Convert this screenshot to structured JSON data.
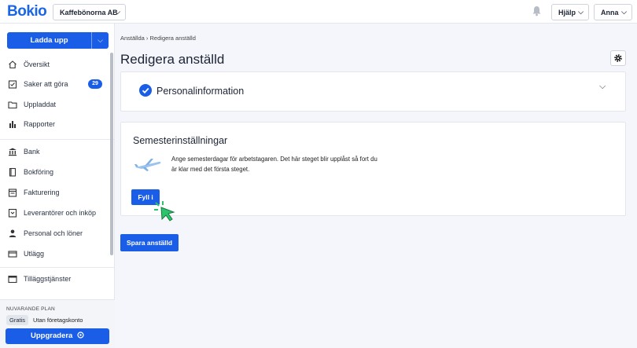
{
  "app": {
    "logo": "Bokio",
    "company": "Kaffebönorna AB",
    "help_label": "Hjälp",
    "user_label": "Anna",
    "accent": "#1a5ee8"
  },
  "sidebar": {
    "upload_label": "Ladda upp",
    "items": [
      {
        "label": "Översikt",
        "icon": "home-icon"
      },
      {
        "label": "Saker att göra",
        "icon": "checklist-icon",
        "badge": "29"
      },
      {
        "label": "Uppladdat",
        "icon": "folder-icon"
      },
      {
        "label": "Rapporter",
        "icon": "bar-chart-icon"
      },
      {
        "label": "Bank",
        "icon": "bank-icon"
      },
      {
        "label": "Bokföring",
        "icon": "book-icon"
      },
      {
        "label": "Fakturering",
        "icon": "invoice-icon"
      },
      {
        "label": "Leverantörer och inköp",
        "icon": "inbox-icon"
      },
      {
        "label": "Personal och löner",
        "icon": "person-icon"
      },
      {
        "label": "Utlägg",
        "icon": "card-icon"
      },
      {
        "label": "Tilläggstjänster",
        "icon": "services-icon"
      }
    ],
    "plan": {
      "title": "NUVARANDE PLAN",
      "name": "Gratis",
      "description": "Utan företagskonto",
      "upgrade_label": "Uppgradera"
    }
  },
  "main": {
    "breadcrumb": "Anställda › Redigera anställd",
    "title": "Redigera anställd",
    "personal_section": "Personalinformation",
    "vacation": {
      "title": "Semesterinställningar",
      "text_line1": "Ange semesterdagar för arbetstagaren. Det här steget blir upplåst så fort du",
      "text_line2": "är klar med det första steget.",
      "fill_label": "Fyll i"
    },
    "save_label": "Spara anställd"
  }
}
